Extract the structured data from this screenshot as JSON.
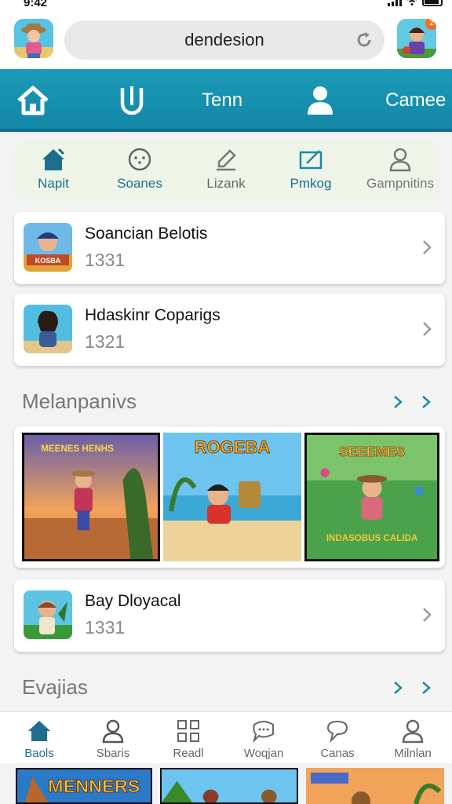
{
  "status": {
    "time": "9:42"
  },
  "header": {
    "search_text": "dendesion",
    "notification_badge": "2"
  },
  "nav": {
    "tenn_label": "Tenn",
    "games_label": "Camee"
  },
  "subnav": {
    "items": [
      {
        "label": "Napit",
        "icon": "home-icon"
      },
      {
        "label": "Soanes",
        "icon": "smile-icon"
      },
      {
        "label": "Lizank",
        "icon": "pencil-icon"
      },
      {
        "label": "Pmkog",
        "icon": "edit-icon"
      },
      {
        "label": "Gampnitins",
        "icon": "person-icon"
      }
    ]
  },
  "cards": [
    {
      "title": "Soancian Belotis",
      "count": "1331"
    },
    {
      "title": "Hdaskinr Coparigs",
      "count": "1321"
    },
    {
      "title": "Bay Dloyacal",
      "count": "1331"
    }
  ],
  "sections": {
    "featured": "Melanpanivs",
    "second": "Evajias"
  },
  "gallery": {
    "items": [
      {
        "caption": "MEENES\nHENHS"
      },
      {
        "caption": "ROGEBA"
      },
      {
        "caption": "SEEEMES",
        "subcaption": "INDASOBUS CALIDA"
      }
    ]
  },
  "card_thumb_caption": "KOSBA",
  "bottom_nav": {
    "items": [
      {
        "label": "Baols",
        "icon": "home-icon",
        "active": true
      },
      {
        "label": "Sbaris",
        "icon": "person-icon"
      },
      {
        "label": "Readl",
        "icon": "grid-icon"
      },
      {
        "label": "Woqjan",
        "icon": "chat-icon"
      },
      {
        "label": "Canas",
        "icon": "speech-icon"
      },
      {
        "label": "Milnlan",
        "icon": "person-icon"
      }
    ]
  },
  "bottom_strip": {
    "caption": "MENNERS"
  },
  "colors": {
    "accent": "#1a9bb9",
    "active": "#1b6f8c"
  }
}
